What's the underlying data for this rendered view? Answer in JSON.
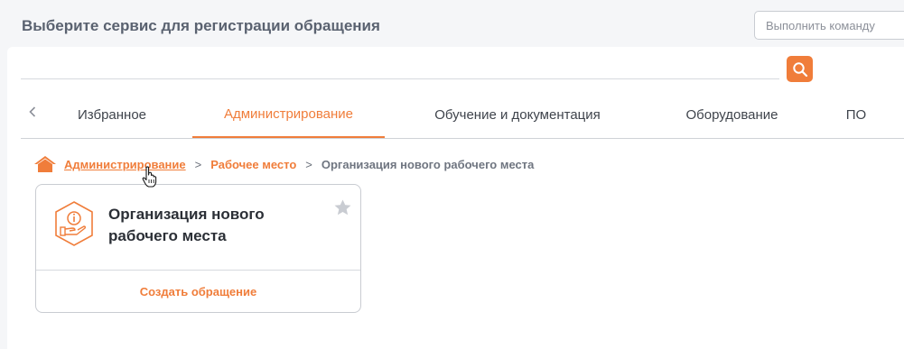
{
  "header": {
    "title": "Выберите сервис для регистрации обращения",
    "command_placeholder": "Выполнить команду"
  },
  "search": {
    "value": ""
  },
  "tabs": [
    {
      "label": "Избранное",
      "active": false
    },
    {
      "label": "Администрирование",
      "active": true
    },
    {
      "label": "Обучение и документация",
      "active": false
    },
    {
      "label": "Оборудование",
      "active": false
    },
    {
      "label": "ПО",
      "active": false
    }
  ],
  "breadcrumb": {
    "items": [
      "Администрирование",
      "Рабочее место",
      "Организация нового рабочего места"
    ],
    "separator": ">"
  },
  "card": {
    "title": "Организация нового рабочего места",
    "action": "Создать обращение"
  },
  "colors": {
    "accent": "#f07d3a",
    "text": "#3a3f47",
    "muted": "#6f7580",
    "background": "#f5f6f8"
  },
  "icons": {
    "search": "search-icon",
    "back": "chevron-left-icon",
    "home": "home-icon",
    "service": "info-hand-icon",
    "favorite": "star-icon",
    "cursor": "hand-cursor-icon"
  }
}
